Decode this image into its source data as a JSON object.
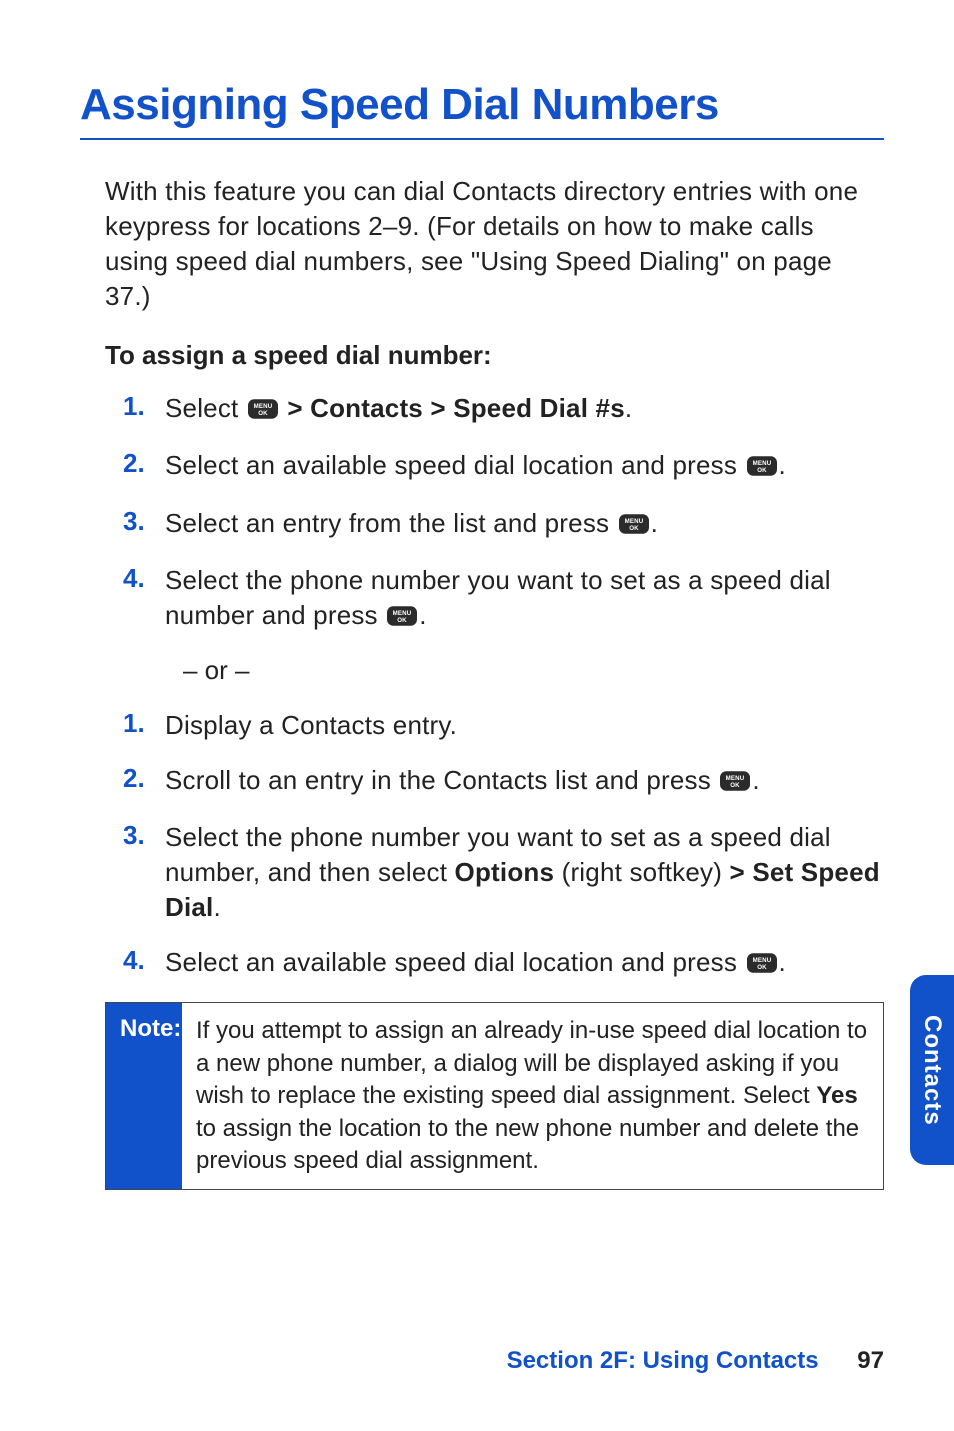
{
  "heading": "Assigning Speed Dial Numbers",
  "intro": "With this feature you can dial Contacts directory entries with one keypress for locations 2–9. (For details on how to make calls using speed dial numbers, see \"Using Speed Dialing\" on page 37.)",
  "subhead": "To assign a speed dial number:",
  "listA": {
    "s1_pre": "Select ",
    "s1_post": " > Contacts > Speed Dial #s",
    "s1_end": ".",
    "s2_pre": "Select an available speed dial location and press ",
    "s2_end": ".",
    "s3_pre": "Select an entry from the list and press ",
    "s3_end": ".",
    "s4_pre": "Select the phone number you want to set as a speed dial number and press ",
    "s4_end": "."
  },
  "or_text": "– or –",
  "listB": {
    "s1": "Display a Contacts entry.",
    "s2_pre": "Scroll to an entry in the Contacts list and press ",
    "s2_end": ".",
    "s3_pre": "Select the phone number you want to set as a speed dial number, and then select ",
    "s3_b1": "Options",
    "s3_mid": " (right softkey) ",
    "s3_b2": "> Set Speed Dial",
    "s3_end": ".",
    "s4_pre": "Select an available speed dial location and press ",
    "s4_end": "."
  },
  "note": {
    "label": "Note:",
    "t1": "If you attempt to assign an already in-use speed dial location to a new phone number, a dialog will be displayed asking if you wish to replace the existing speed dial assignment. Select ",
    "b1": "Yes",
    "t2": " to assign the location to the new phone number and delete the previous speed dial assignment."
  },
  "side_tab": "Contacts",
  "footer_section": "Section 2F: Using Contacts",
  "footer_page": "97",
  "nums": {
    "n1": "1.",
    "n2": "2.",
    "n3": "3.",
    "n4": "4."
  }
}
